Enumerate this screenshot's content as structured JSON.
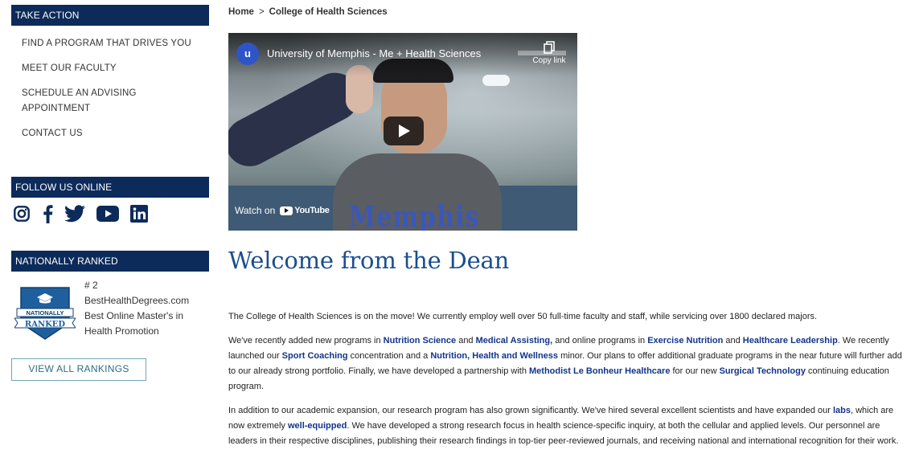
{
  "sidebar": {
    "take_action": {
      "heading": "TAKE ACTION",
      "items": [
        {
          "label": "FIND A PROGRAM THAT DRIVES YOU"
        },
        {
          "label": "MEET OUR FACULTY"
        },
        {
          "label": "SCHEDULE AN ADVISING APPOINTMENT"
        },
        {
          "label": "CONTACT US"
        }
      ]
    },
    "follow": {
      "heading": "FOLLOW US ONLINE",
      "icons": [
        "instagram-icon",
        "facebook-icon",
        "twitter-icon",
        "youtube-icon",
        "linkedin-icon"
      ]
    },
    "ranked": {
      "heading": "NATIONALLY RANKED",
      "badge_line1": "NATIONALLY",
      "badge_line2": "RANKED",
      "rank": "# 2",
      "source": "BestHealthDegrees.com",
      "desc": "Best Online Master's in Health Promotion",
      "button": "VIEW ALL RANKINGS"
    }
  },
  "breadcrumb": {
    "home": "Home",
    "separator": ">",
    "current": "College of Health Sciences"
  },
  "video": {
    "channel_initial": "u",
    "title": "University of Memphis - Me + Health Sciences",
    "copy_link": "Copy link",
    "watch_on": "Watch on",
    "youtube": "YouTube",
    "shirt_text": "Memphis"
  },
  "main": {
    "title": "Welcome from the Dean",
    "p1": "The College of Health Sciences is on the move! We currently employ well over 50 full-time faculty and staff, while servicing over 1800 declared majors.",
    "p2": {
      "t1": "We've recently added new programs in ",
      "l1": "Nutrition Science",
      "t2": " and ",
      "l2": "Medical Assisting,",
      "t3": " and online programs in ",
      "l3": "Exercise Nutrition",
      "t4": " and ",
      "l4": "Healthcare Leadership",
      "t5": ". We recently launched our ",
      "l5": "Sport Coaching",
      "t6": " concentration and a ",
      "l6": "Nutrition, Health and Wellness",
      "t7": " minor. Our plans to offer additional graduate programs in the near future will further add to our already strong portfolio. Finally, we have developed a partnership with ",
      "l7": "Methodist Le Bonheur Healthcare",
      "t8": " for our new ",
      "l8": "Surgical Technology",
      "t9": " continuing education program."
    },
    "p3": {
      "t1": "In addition to our academic expansion, our research program has also grown significantly. We've hired several excellent scientists and have expanded our ",
      "l1": "labs",
      "t2": ", which are now extremely ",
      "l2": "well-equipped",
      "t3": ". We have developed a strong research focus in health science-specific inquiry, at both the cellular and applied levels. Our personnel are leaders in their respective disciplines, publishing their research findings in top-tier peer-reviewed journals, and receiving national and international recognition for their work."
    }
  },
  "colors": {
    "navy": "#0d2b5a",
    "link": "#12348a",
    "title": "#1b4e8f",
    "button_border": "#6ea8b8"
  }
}
